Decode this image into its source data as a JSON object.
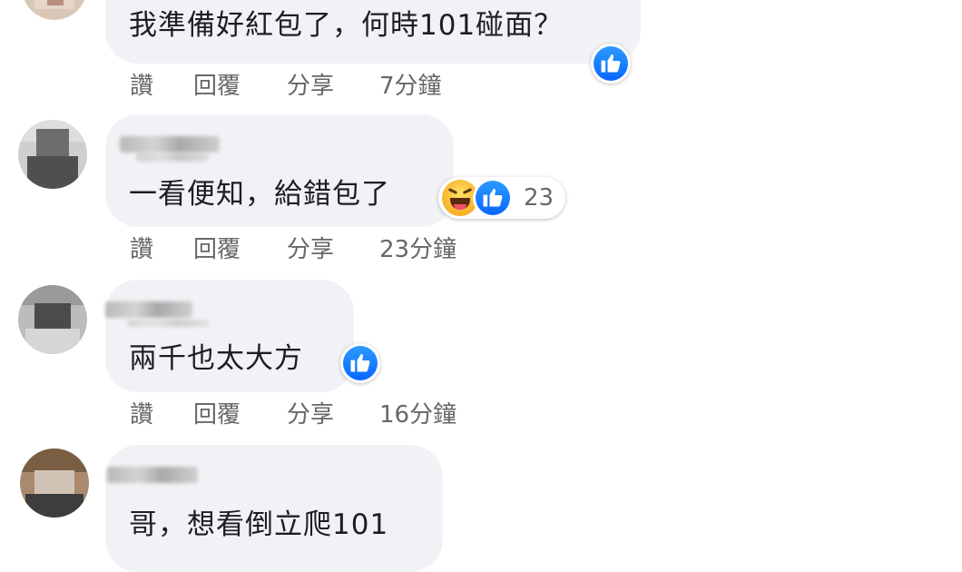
{
  "comments": [
    {
      "text": "我準備好紅包了，何時101碰面？",
      "actions": {
        "like": "讚",
        "reply": "回覆",
        "share": "分享",
        "time": "7分鐘"
      },
      "reaction_icon": "like-icon"
    },
    {
      "text": "一看便知，給錯包了",
      "actions": {
        "like": "讚",
        "reply": "回覆",
        "share": "分享",
        "time": "23分鐘"
      },
      "reaction_icons": [
        "haha-icon",
        "like-icon"
      ],
      "reaction_count": "23"
    },
    {
      "text": "兩千也太大方",
      "actions": {
        "like": "讚",
        "reply": "回覆",
        "share": "分享",
        "time": "16分鐘"
      },
      "reaction_icon": "like-icon"
    },
    {
      "text": "哥，想看倒立爬101"
    }
  ],
  "colors": {
    "bubble": "#f0f2f5",
    "secondary_text": "#65676b",
    "like_blue": "#0866ff"
  }
}
